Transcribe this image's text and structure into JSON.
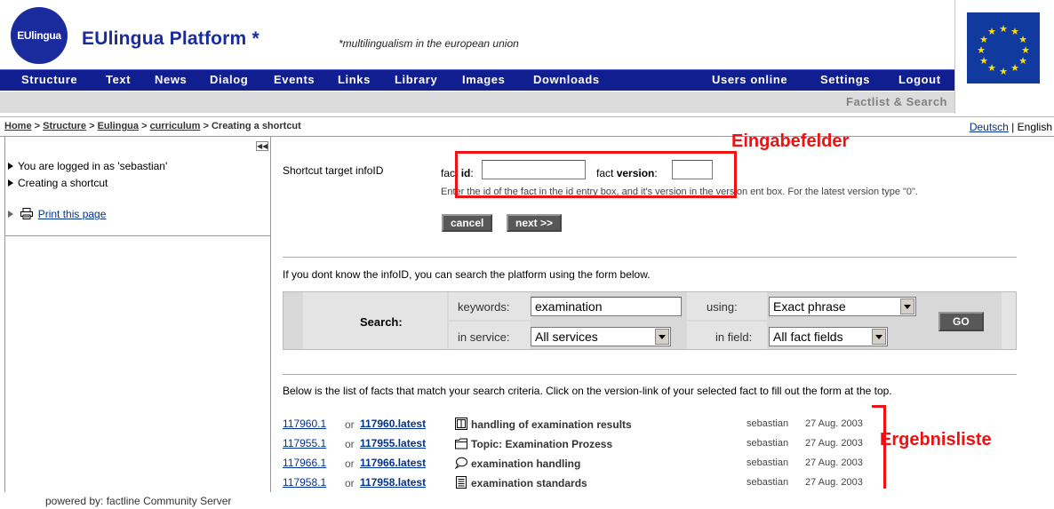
{
  "header": {
    "logo_text": "EUlingua",
    "title": "EUlingua Platform *",
    "subtitle": "*multilingualism in the european union"
  },
  "nav": {
    "items": [
      "Structure",
      "Text",
      "News",
      "Dialog",
      "Events",
      "Links",
      "Library",
      "Images",
      "Downloads"
    ],
    "right_items": [
      "Users online",
      "Settings",
      "Logout"
    ]
  },
  "subbar": {
    "link": "Factlist & Search"
  },
  "breadcrumb": {
    "items": [
      "Home",
      "Structure",
      "Eulingua",
      "curriculum"
    ],
    "separator": " > ",
    "current": "Creating a shortcut"
  },
  "lang": {
    "deutsch": "Deutsch",
    "sep": " | ",
    "english": "English"
  },
  "sidebar": {
    "logged_in": "You are logged in as 'sebastian'",
    "current_action": "Creating a shortcut",
    "print_link": "Print this page"
  },
  "form": {
    "target_label": "Shortcut target infoID",
    "fact_id_prefix": "fact ",
    "fact_id_bold": "id",
    "fact_id_suffix": ":",
    "fact_id_value": "",
    "fact_version_prefix": "fact ",
    "fact_version_bold": "version",
    "fact_version_suffix": ":",
    "fact_version_value": "",
    "help_text": "Enter the id of the fact in the id entry box, and it's version in the version ent     box. For the latest version type \"0\".",
    "cancel_label": "cancel",
    "next_label": "next >>"
  },
  "search": {
    "intro": "If you dont know the infoID, you can search the platform using the form below.",
    "label": "Search:",
    "keywords_label": "keywords:",
    "keywords_value": "examination",
    "using_label": "using:",
    "using_value": "Exact phrase",
    "service_label": "in service:",
    "service_value": "All services",
    "field_label": "in field:",
    "field_value": "All fact fields",
    "go_label": "GO"
  },
  "results": {
    "intro": "Below is the list of facts that match your search criteria. Click on the version-link of your selected fact to fill out the form at the top.",
    "or_text": "or",
    "rows": [
      {
        "id": "117960.1",
        "latest": "117960.latest",
        "icon": "book-icon",
        "title": "handling of examination results",
        "user": "sebastian",
        "date": "27 Aug. 2003"
      },
      {
        "id": "117955.1",
        "latest": "117955.latest",
        "icon": "folder-icon",
        "title": "Topic: Examination Prozess",
        "user": "sebastian",
        "date": "27 Aug. 2003"
      },
      {
        "id": "117966.1",
        "latest": "117966.latest",
        "icon": "speech-bubble-icon",
        "title": "examination handling",
        "user": "sebastian",
        "date": "27 Aug. 2003"
      },
      {
        "id": "117958.1",
        "latest": "117958.latest",
        "icon": "document-icon",
        "title": "examination standards",
        "user": "sebastian",
        "date": "27 Aug. 2003"
      }
    ]
  },
  "annotations": {
    "input_fields": "Eingabefelder",
    "result_list": "Ergebnisliste",
    "color": "#ee1111"
  },
  "footer": {
    "text": "powered by: factline Community Server"
  }
}
